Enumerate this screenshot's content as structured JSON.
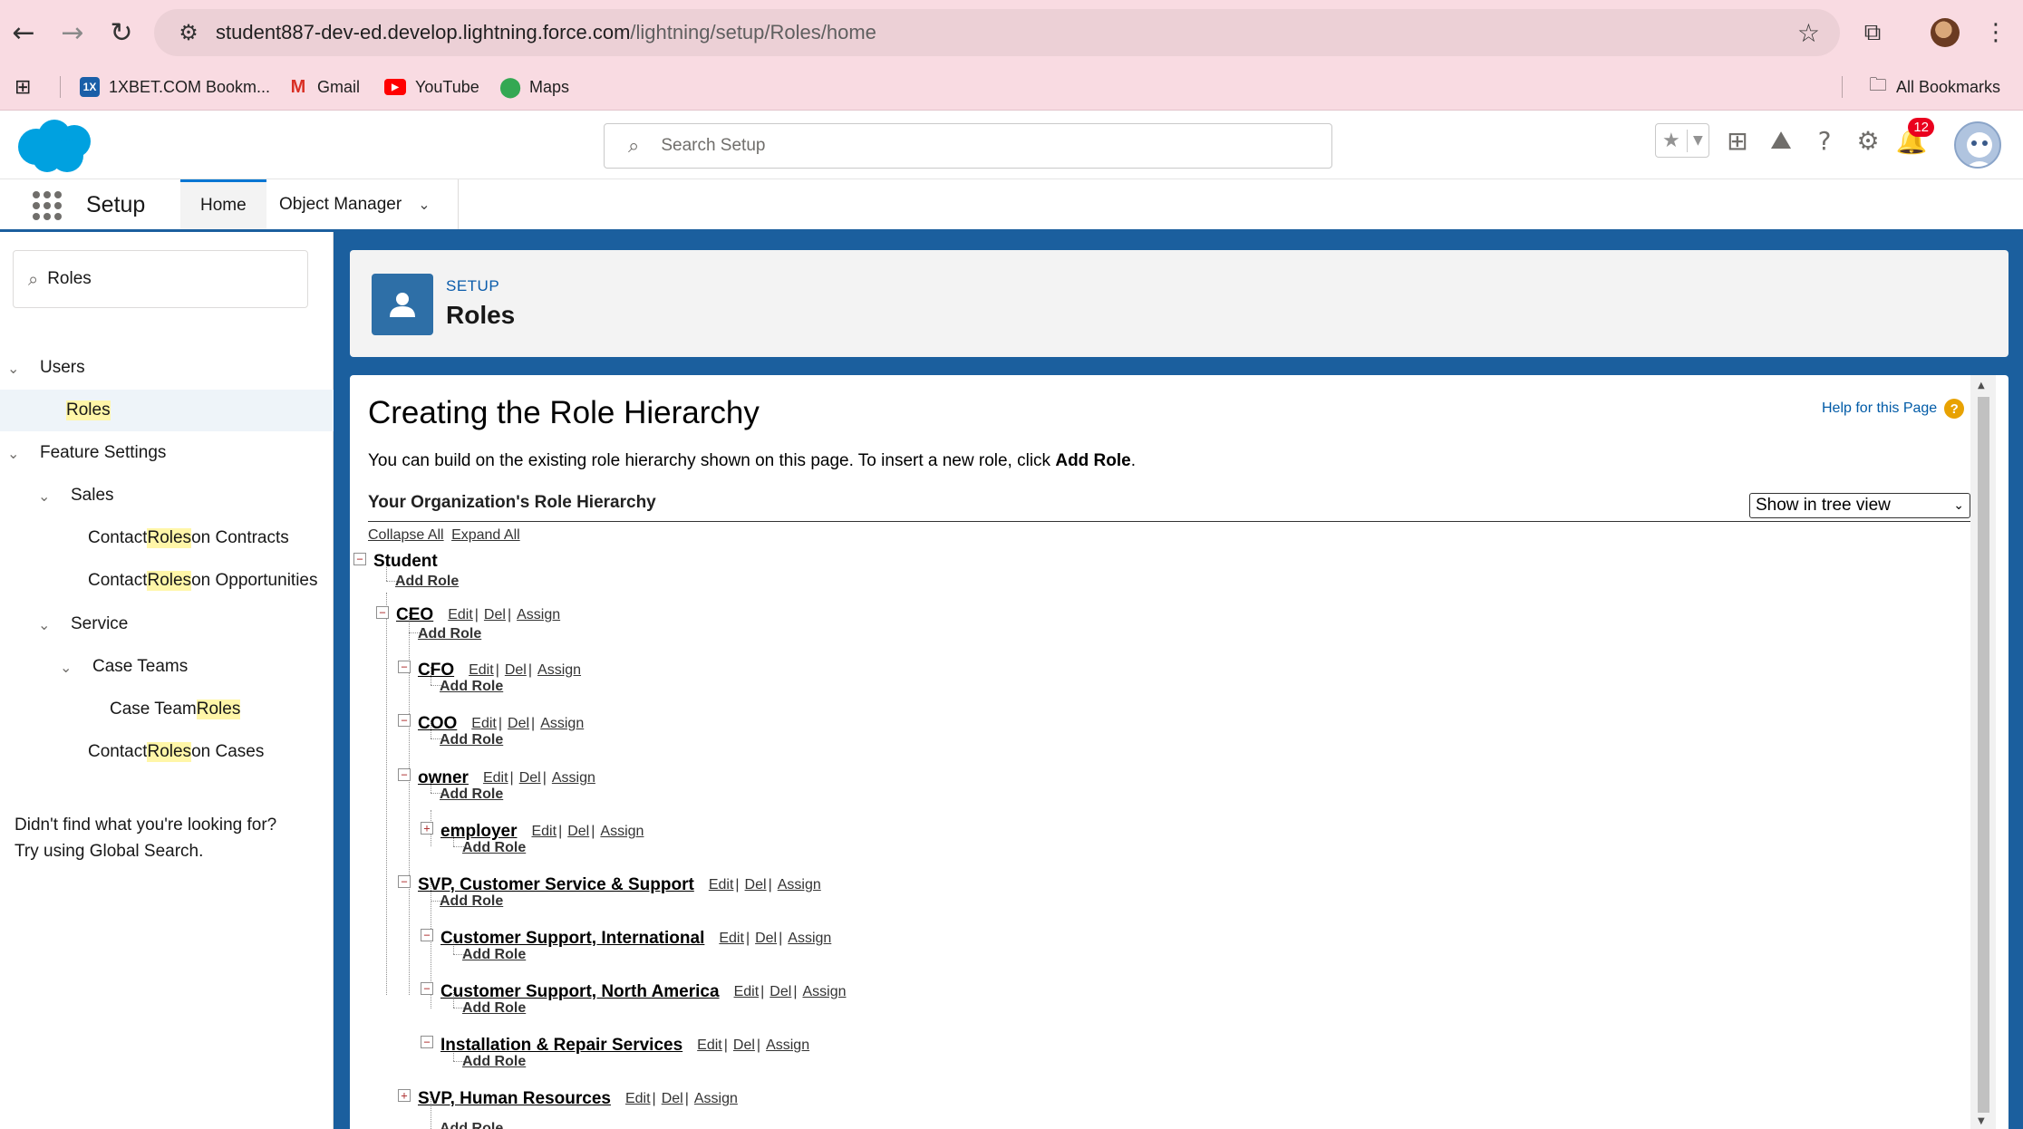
{
  "browser": {
    "url_host": "student887-dev-ed.develop.lightning.force.com",
    "url_path": "/lightning/setup/Roles/home",
    "bookmarks": [
      {
        "label": "1XBET.COM Bookm...",
        "icon": "1xbet-icon"
      },
      {
        "label": "Gmail",
        "icon": "gmail-icon"
      },
      {
        "label": "YouTube",
        "icon": "youtube-icon"
      },
      {
        "label": "Maps",
        "icon": "maps-icon"
      }
    ],
    "all_bookmarks": "All Bookmarks"
  },
  "header": {
    "search_placeholder": "Search Setup",
    "notification_count": "12"
  },
  "nav": {
    "app_name": "Setup",
    "tabs": [
      {
        "label": "Home",
        "active": true
      },
      {
        "label": "Object Manager",
        "active": false
      }
    ]
  },
  "sidebar": {
    "quick_find_value": "Roles",
    "items": [
      {
        "label": "Users"
      },
      {
        "label": "Roles"
      },
      {
        "label": "Feature Settings"
      },
      {
        "label": "Sales"
      },
      {
        "pre": "Contact ",
        "hl": "Roles",
        "post": " on Contracts"
      },
      {
        "pre": "Contact ",
        "hl": "Roles",
        "post": " on Opportunities"
      },
      {
        "label": "Service"
      },
      {
        "label": "Case Teams"
      },
      {
        "pre": "Case Team ",
        "hl": "Roles",
        "post": ""
      },
      {
        "pre": "Contact ",
        "hl": "Roles",
        "post": " on Cases"
      }
    ],
    "not_found_line1": "Didn't find what you're looking for?",
    "not_found_line2": "Try using Global Search."
  },
  "page_header": {
    "eyebrow": "SETUP",
    "title": "Roles"
  },
  "content": {
    "heading": "Creating the Role Hierarchy",
    "help_link": "Help for this Page",
    "intro_text": "You can build on the existing role hierarchy shown on this page. To insert a new role, click ",
    "intro_bold": "Add Role",
    "intro_end": ".",
    "section_title": "Your Organization's Role Hierarchy",
    "view_select": "Show in tree view",
    "collapse_all": "Collapse All",
    "expand_all": "Expand All",
    "root_role": "Student",
    "add_role": "Add Role",
    "edit": "Edit",
    "del": "Del",
    "assign": "Assign",
    "roles": [
      {
        "name": "CEO"
      },
      {
        "name": "CFO"
      },
      {
        "name": "COO"
      },
      {
        "name": "owner"
      },
      {
        "name": "employer"
      },
      {
        "name": "SVP, Customer Service & Support"
      },
      {
        "name": "Customer Support, International"
      },
      {
        "name": "Customer Support, North America"
      },
      {
        "name": "Installation & Repair Services"
      },
      {
        "name": "SVP, Human Resources"
      }
    ]
  },
  "colors": {
    "brand_blue": "#1b5f9e",
    "link_blue": "#015ba7",
    "highlight": "#fff6a8"
  }
}
